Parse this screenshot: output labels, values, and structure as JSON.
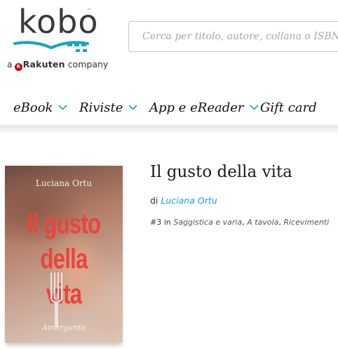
{
  "logo": {
    "word": "kobo",
    "trademark": "™",
    "tagline_prefix": "a",
    "tagline_brand": "Rakuten",
    "tagline_suffix": "company",
    "colors": {
      "text": "#3a3a3a",
      "book_accent": "#1aa2c7",
      "rakuten": "#bf0000"
    }
  },
  "search": {
    "placeholder": "Cerca per titolo, autore, collana o ISBN",
    "value": ""
  },
  "nav": {
    "items": [
      {
        "label": "eBook",
        "has_dropdown": true
      },
      {
        "label": "Riviste",
        "has_dropdown": true
      },
      {
        "label": "App e eReader",
        "has_dropdown": true
      },
      {
        "label": "Gift card",
        "has_dropdown": false
      }
    ],
    "chevron_icon": "chevron-down-icon",
    "chevron_color": "#1aa2c7"
  },
  "book": {
    "cover": {
      "author": "Luciana Ortu",
      "title_line1": "Il gusto",
      "title_line2": "della vita",
      "publisher": "Amarganta"
    },
    "title": "Il gusto della vita",
    "by_label": "di",
    "author": "Luciana Ortu",
    "rank": {
      "position": "#3",
      "in_label": "in",
      "categories": [
        "Saggistica e varia",
        "A tavola",
        "Ricevimenti"
      ]
    }
  }
}
